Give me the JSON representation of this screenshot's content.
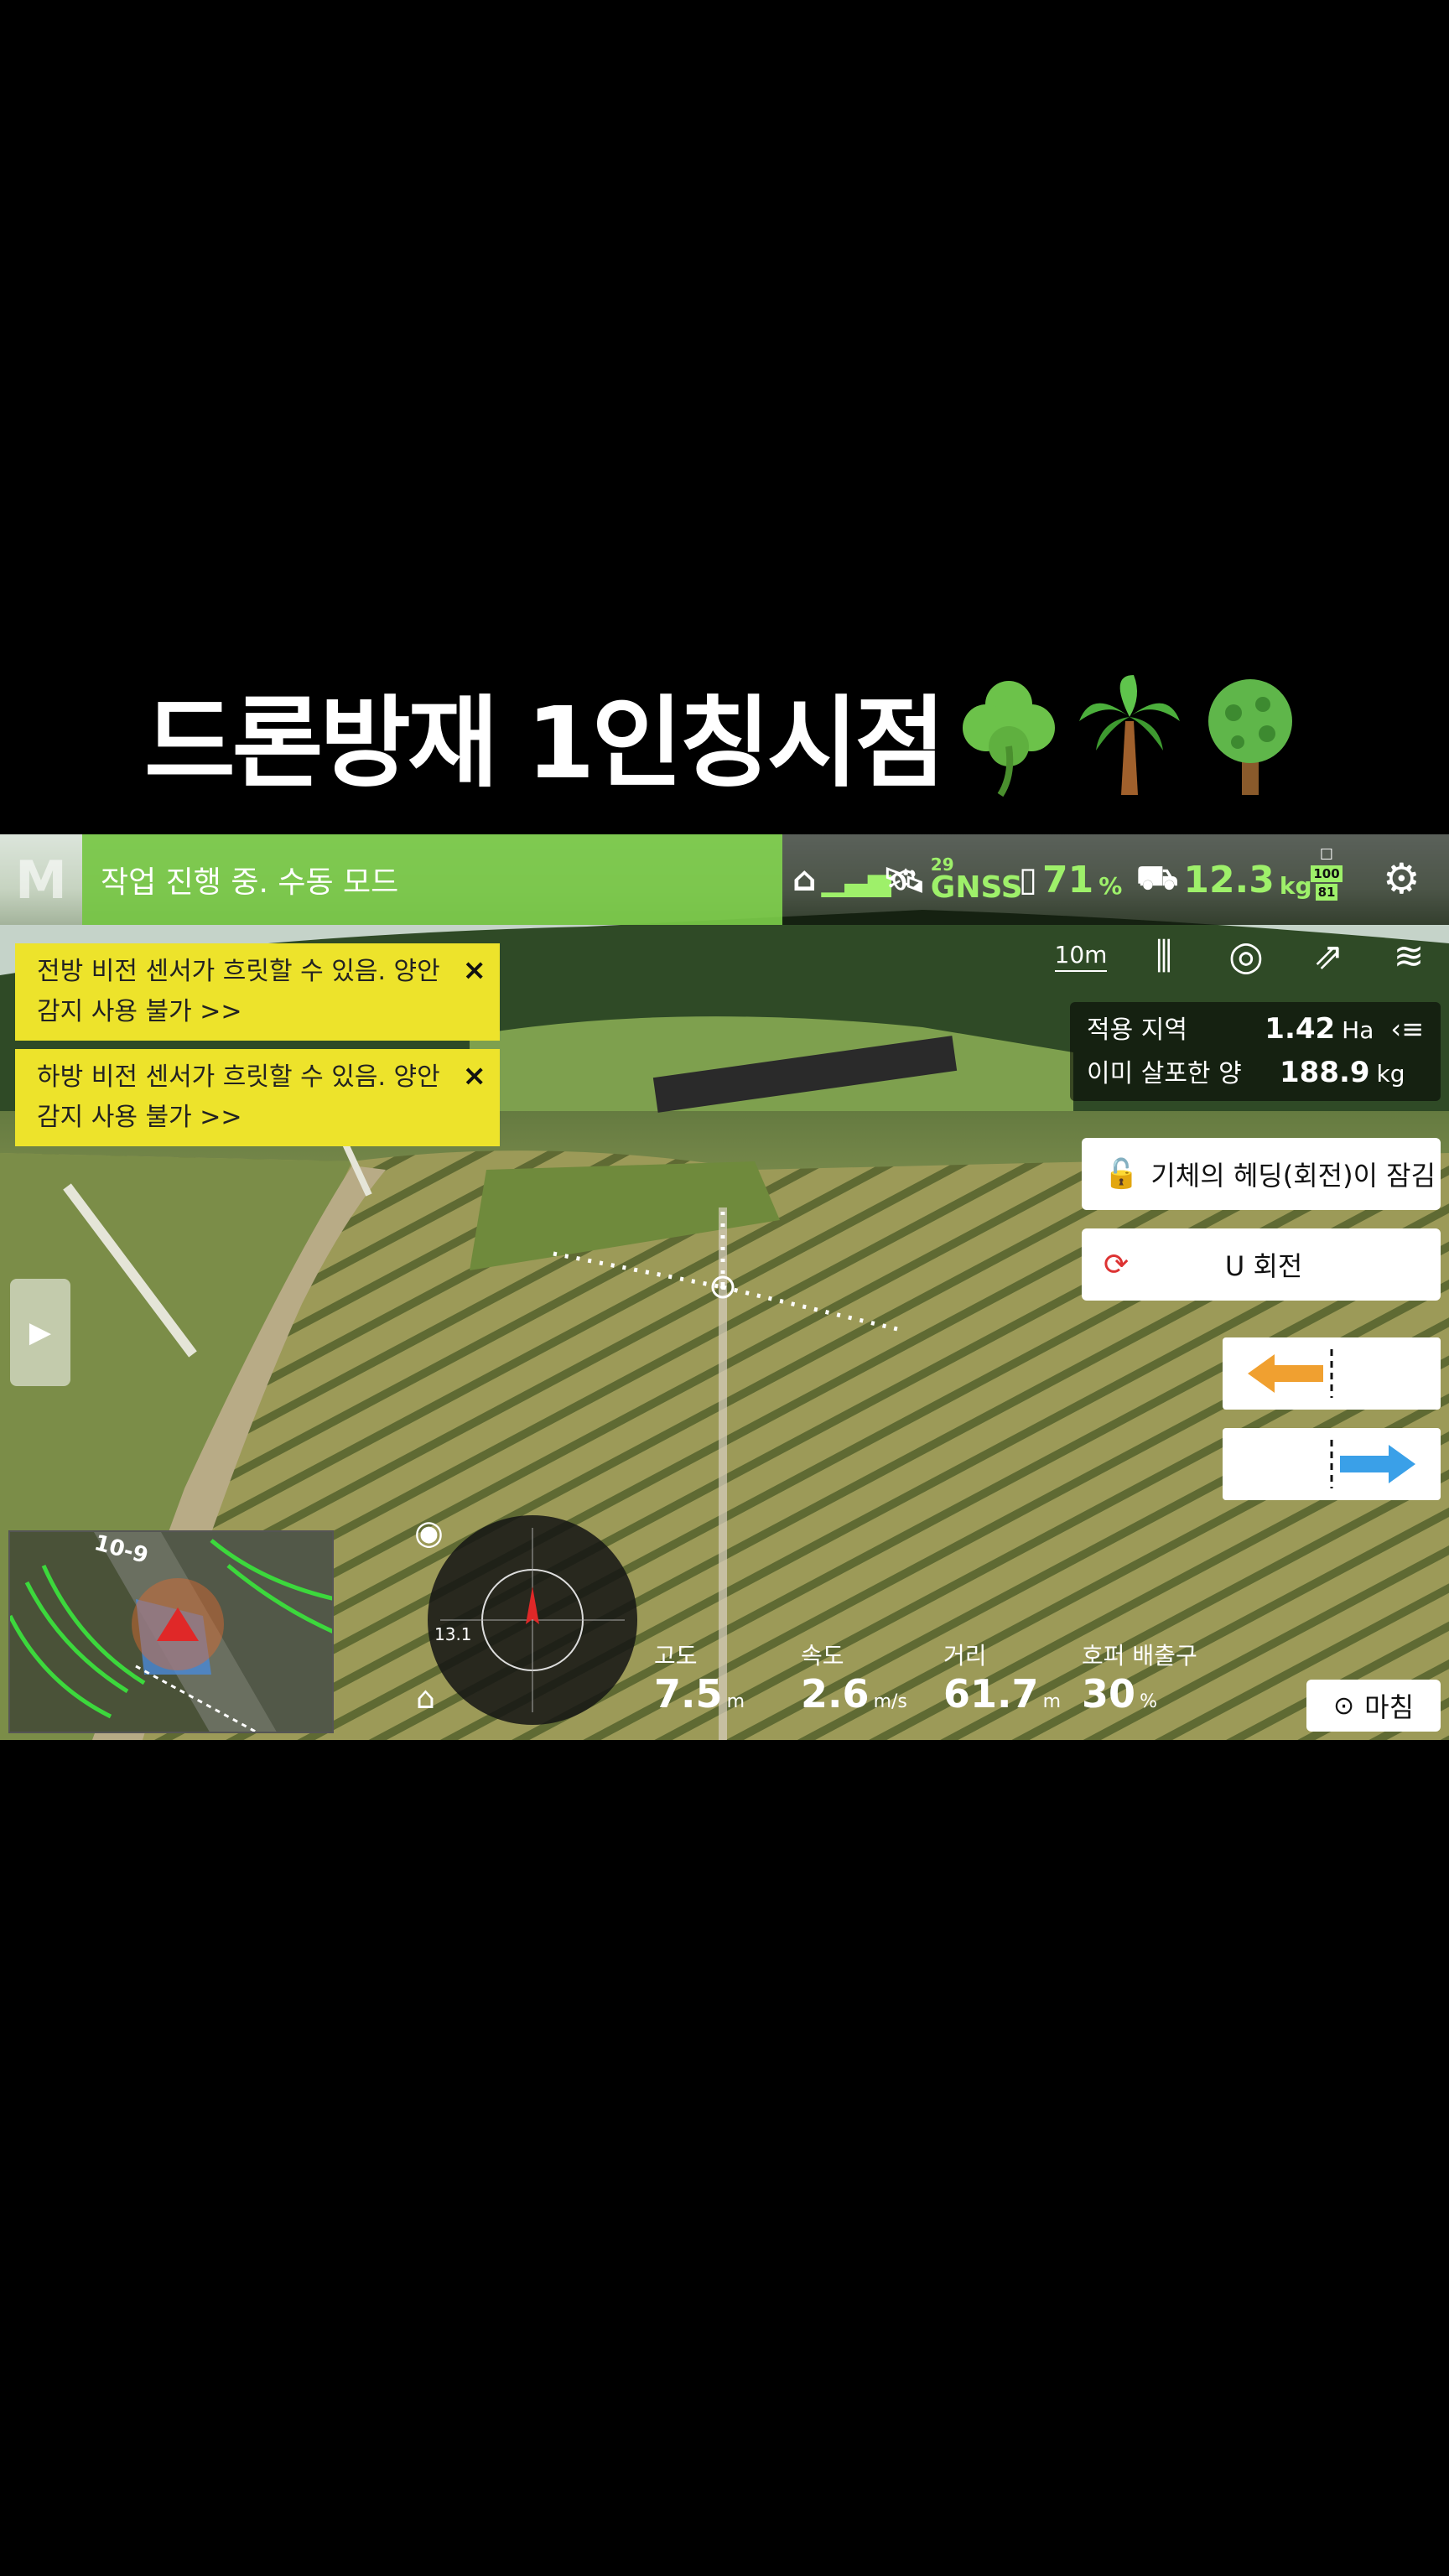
{
  "caption": {
    "text": "드론방재 1인칭시점"
  },
  "topbar": {
    "logo": "M",
    "status": "작업 진행 중. 수동 모드",
    "gnss_count": "29",
    "gnss_label": "GNSS",
    "battery_value": "71",
    "battery_unit": "%",
    "payload_value": "12.3",
    "payload_unit": "kg",
    "rc_top": "100",
    "rc_bottom": "81"
  },
  "warnings": [
    {
      "text": "전방 비전 센서가 흐릿할 수 있음. 양안 감지 사용 불가 >>",
      "close": "×"
    },
    {
      "text": "하방 비전 센서가 흐릿할 수 있음. 양안 감지 사용 불가 >>",
      "close": "×"
    }
  ],
  "toolbar": {
    "scale": "10m"
  },
  "info": {
    "area_label": "적용 지역",
    "area_value": "1.42",
    "area_unit": "Ha",
    "sprayed_label": "이미 살포한 양",
    "sprayed_value": "188.9",
    "sprayed_unit": "kg"
  },
  "buttons": {
    "heading_lock": "기체의 헤딩(회전)이 잠김",
    "u_turn": "U 회전",
    "end": "마침"
  },
  "map": {
    "label": "10-9"
  },
  "compass": {
    "value": "13.1"
  },
  "telemetry": [
    {
      "label": "고도",
      "value": "7.5",
      "unit": "m"
    },
    {
      "label": "속도",
      "value": "2.6",
      "unit": "m/s"
    },
    {
      "label": "거리",
      "value": "61.7",
      "unit": "m"
    },
    {
      "label": "호퍼 배출구",
      "value": "30",
      "unit": "%"
    }
  ],
  "colors": {
    "accent_green": "#9ef06a",
    "status_green": "#78c846",
    "warning_yellow": "#ede32b"
  }
}
